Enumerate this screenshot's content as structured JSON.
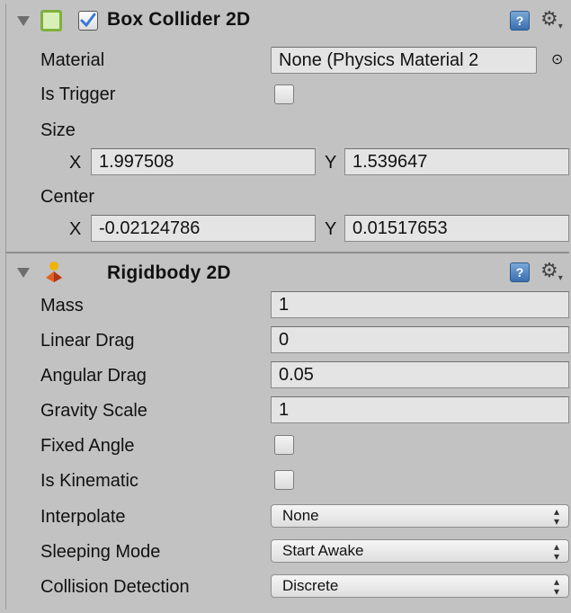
{
  "box_collider": {
    "title": "Box Collider 2D",
    "enabled": true,
    "material_label": "Material",
    "material_value": "None (Physics Material 2",
    "is_trigger_label": "Is Trigger",
    "is_trigger": false,
    "size_label": "Size",
    "size_x_label": "X",
    "size_x": "1.997508",
    "size_y_label": "Y",
    "size_y": "1.539647",
    "center_label": "Center",
    "center_x_label": "X",
    "center_x": "-0.02124786",
    "center_y_label": "Y",
    "center_y": "0.01517653"
  },
  "rigidbody": {
    "title": "Rigidbody 2D",
    "mass_label": "Mass",
    "mass": "1",
    "linear_drag_label": "Linear Drag",
    "linear_drag": "0",
    "angular_drag_label": "Angular Drag",
    "angular_drag": "0.05",
    "gravity_scale_label": "Gravity Scale",
    "gravity_scale": "1",
    "fixed_angle_label": "Fixed Angle",
    "fixed_angle": false,
    "is_kinematic_label": "Is Kinematic",
    "is_kinematic": false,
    "interpolate_label": "Interpolate",
    "interpolate": "None",
    "sleeping_mode_label": "Sleeping Mode",
    "sleeping_mode": "Start Awake",
    "collision_detection_label": "Collision Detection",
    "collision_detection": "Discrete"
  },
  "icons": {
    "help": "?",
    "gear": "⚙",
    "object_picker": "⊙",
    "dropdown_arrows": "▲▼"
  },
  "colors": {
    "panel_bg": "#c2c2c2",
    "field_bg": "#e4e4e4",
    "checkbox_accent": "#3b78d8",
    "collider_icon": "#8bc34a"
  }
}
